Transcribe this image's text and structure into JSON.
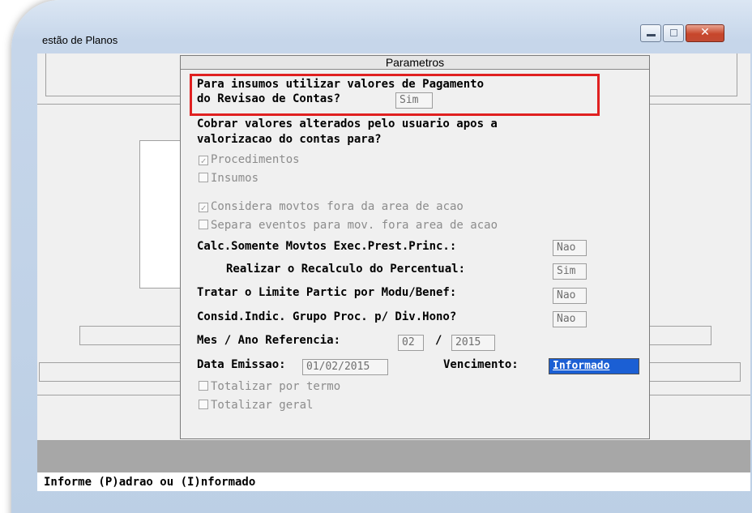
{
  "window": {
    "title": "estão de Planos"
  },
  "dialog": {
    "title": "Parametros",
    "q_insumos_line1": "Para insumos utilizar valores de Pagamento",
    "q_insumos_line2": "do Revisao de Contas?",
    "q_insumos_value": "Sim",
    "cobrar_line1": "Cobrar valores alterados pelo usuario apos a",
    "cobrar_line2": "valorizacao do contas para?",
    "chk_procedimentos": "Procedimentos",
    "chk_insumos": "Insumos",
    "chk_considera": "Considera movtos fora da area de acao",
    "chk_separa": "Separa eventos para mov. fora area de acao",
    "calc_label": "Calc.Somente Movtos Exec.Prest.Princ.:",
    "calc_value": "Nao",
    "realizar_label": "Realizar o Recalculo do Percentual:",
    "realizar_value": "Sim",
    "tratar_label": "Tratar o Limite Partic por Modu/Benef:",
    "tratar_value": "Nao",
    "consid_label": "Consid.Indic. Grupo Proc. p/ Div.Hono?",
    "consid_value": "Nao",
    "mes_ano_label": "Mes / Ano Referencia:",
    "mes_value": "02",
    "slash": "/",
    "ano_value": "2015",
    "data_emissao_label": "Data Emissao:",
    "data_emissao_value": "01/02/2015",
    "vencimento_label": "Vencimento:",
    "vencimento_value": "Informado",
    "chk_totalizar_termo": "Totalizar por termo",
    "chk_totalizar_geral": "Totalizar geral",
    "check_mark": "✓"
  },
  "status": {
    "text": "Informe (P)adrao ou (I)nformado"
  }
}
